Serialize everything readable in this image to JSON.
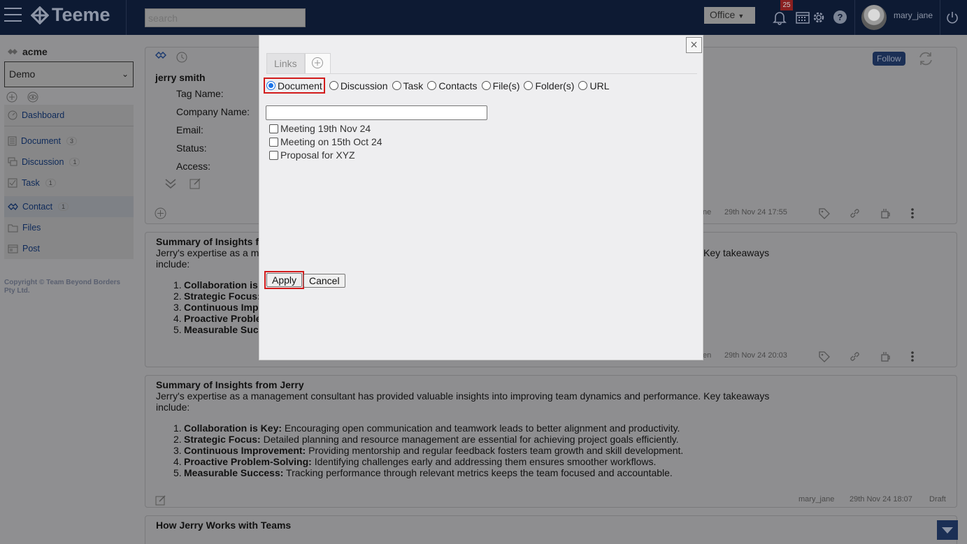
{
  "app": {
    "name": "Teeme",
    "search_placeholder": "search",
    "office_select": "Office",
    "notification_count": "25",
    "username": "mary_jane",
    "colors": {
      "topbar": "#0d1a33",
      "highlight": "#d21b1b",
      "radio_selected": "#1a73e8"
    }
  },
  "sidebar": {
    "org": "acme",
    "workspace": "Demo",
    "items": [
      {
        "label": "Dashboard",
        "count": ""
      },
      {
        "label": "Document",
        "count": "3"
      },
      {
        "label": "Discussion",
        "count": "1"
      },
      {
        "label": "Task",
        "count": "1"
      },
      {
        "label": "Contact",
        "count": "1"
      },
      {
        "label": "Files",
        "count": ""
      },
      {
        "label": "Post",
        "count": ""
      }
    ],
    "copyright": "Copyright © Team Beyond Borders Pty Ltd."
  },
  "contact_card": {
    "name": "jerry smith",
    "fields": [
      "Tag Name:",
      "Company Name:",
      "Email:",
      "Status:",
      "Access:"
    ],
    "follow": "Follow",
    "author_fragment": "ne",
    "timestamp": "29th Nov 24 17:55"
  },
  "doc_card_1": {
    "title": "Summary of Insights f",
    "body_line1": "Jerry's expertise as a m",
    "body_tail": "Key takeaways",
    "body_line2": "include:",
    "items": [
      "Collaboration is",
      "Strategic Focus:",
      "Continuous Impr",
      "Proactive Proble",
      "Measurable Succ"
    ],
    "author_fragment": "en",
    "timestamp": "29th Nov 24 20:03"
  },
  "doc_card_2": {
    "title": "Summary of Insights from Jerry",
    "body": "Jerry's expertise as a management consultant has provided valuable insights into improving team dynamics and performance. Key takeaways include:",
    "items": [
      {
        "bold": "Collaboration is Key:",
        "text": " Encouraging open communication and teamwork leads to better alignment and productivity."
      },
      {
        "bold": "Strategic Focus:",
        "text": " Detailed planning and resource management are essential for achieving project goals efficiently."
      },
      {
        "bold": "Continuous Improvement:",
        "text": " Providing mentorship and regular feedback fosters team growth and skill development."
      },
      {
        "bold": "Proactive Problem-Solving:",
        "text": " Identifying challenges early and addressing them ensures smoother workflows."
      },
      {
        "bold": "Measurable Success:",
        "text": " Tracking performance through relevant metrics keeps the team focused and accountable."
      }
    ],
    "author": "mary_jane",
    "timestamp": "29th Nov 24 18:07",
    "status": "Draft"
  },
  "doc_card_3": {
    "title": "How Jerry Works with Teams"
  },
  "modal": {
    "tab_links": "Links",
    "radio_options": [
      "Document",
      "Discussion",
      "Task",
      "Contacts",
      "File(s)",
      "Folder(s)",
      "URL"
    ],
    "selected": "Document",
    "filter_value": "",
    "documents": [
      "Meeting 19th Nov 24",
      "Meeting on 15th Oct 24",
      "Proposal for XYZ"
    ],
    "apply": "Apply",
    "cancel": "Cancel"
  }
}
